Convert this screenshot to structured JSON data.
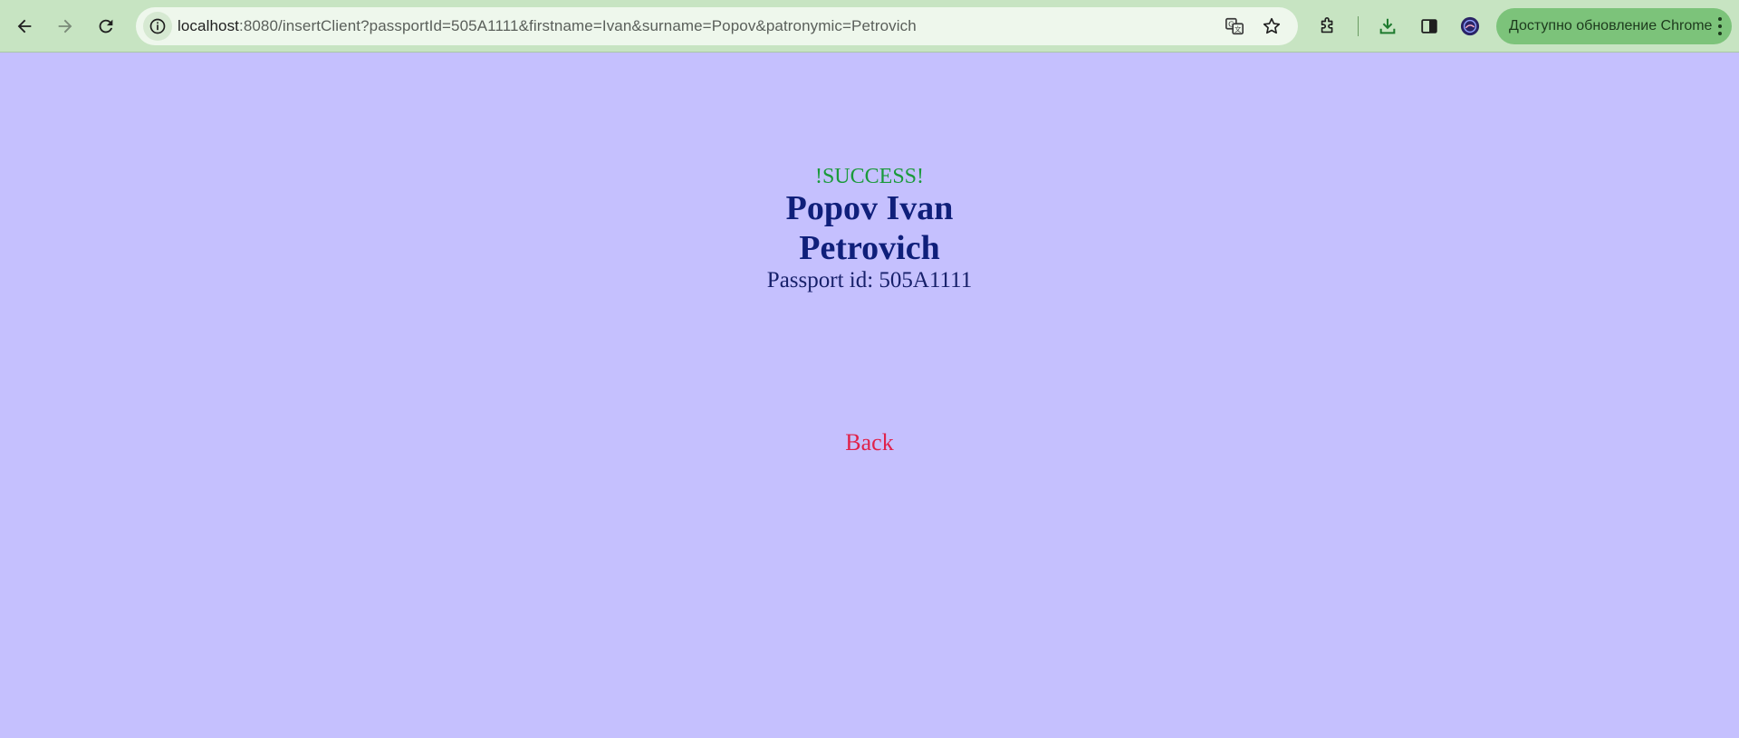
{
  "browser": {
    "url_host": "localhost",
    "url_rest": ":8080/insertClient?passportId=505A1111&firstname=Ivan&surname=Popov&patronymic=Petrovich",
    "update_label": "Доступно обновление Chrome",
    "icons": [
      "back-arrow-icon",
      "forward-arrow-icon",
      "reload-icon",
      "site-info-icon",
      "translate-icon",
      "bookmark-star-icon",
      "extensions-icon",
      "download-icon",
      "side-panel-icon",
      "profile-avatar",
      "kebab-menu-icon"
    ]
  },
  "page": {
    "status": "!SUCCESS!",
    "full_name": "Popov Ivan Petrovich",
    "passport_line": "Passport id: 505A1111",
    "back_link": "Back"
  },
  "colors": {
    "page_background": "#c5c0fe",
    "toolbar_background": "#c7e4c2",
    "success": "#1a9a3a",
    "name": "#0f1f7a",
    "back_link": "#e0224a"
  }
}
